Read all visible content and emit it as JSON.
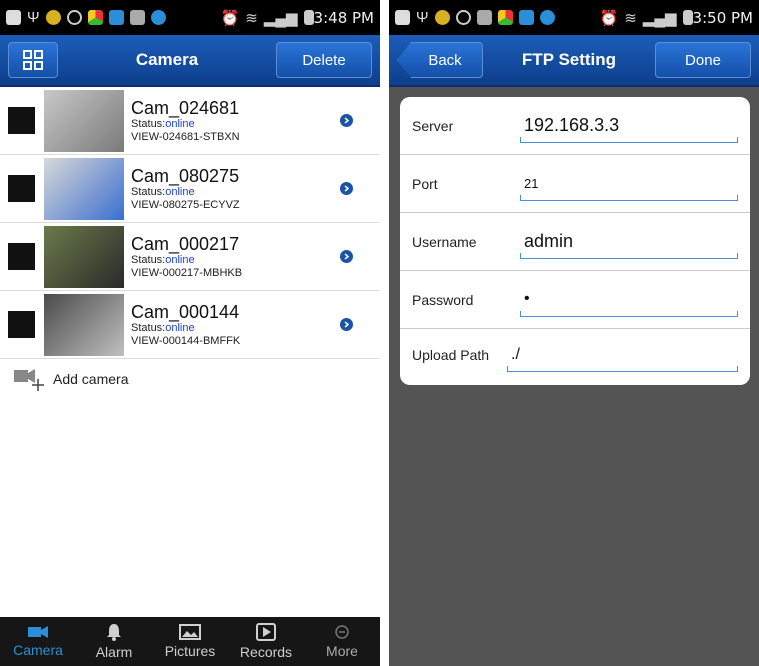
{
  "left": {
    "status_bar": {
      "time": "3:48 PM"
    },
    "header": {
      "title": "Camera",
      "delete_label": "Delete"
    },
    "cameras": [
      {
        "name": "Cam_024681",
        "status_label": "Status:",
        "status_value": "online",
        "uid": "VIEW-024681-STBXN",
        "thumb_colors": [
          "#c8c8c8",
          "#7a7a7a"
        ]
      },
      {
        "name": "Cam_080275",
        "status_label": "Status:",
        "status_value": "online",
        "uid": "VIEW-080275-ECYVZ",
        "thumb_colors": [
          "#d8d8d8",
          "#3a6fd0"
        ]
      },
      {
        "name": "Cam_000217",
        "status_label": "Status:",
        "status_value": "online",
        "uid": "VIEW-000217-MBHKB",
        "thumb_colors": [
          "#6a7a4a",
          "#2a2a2a"
        ]
      },
      {
        "name": "Cam_000144",
        "status_label": "Status:",
        "status_value": "online",
        "uid": "VIEW-000144-BMFFK",
        "thumb_colors": [
          "#4a4a4a",
          "#c0c0c0"
        ]
      }
    ],
    "add_camera_label": "Add camera",
    "tabs": [
      {
        "label": "Camera",
        "icon": "camera-icon",
        "active": true
      },
      {
        "label": "Alarm",
        "icon": "bell-icon",
        "active": false
      },
      {
        "label": "Pictures",
        "icon": "picture-icon",
        "active": false
      },
      {
        "label": "Records",
        "icon": "play-icon",
        "active": false
      },
      {
        "label": "More",
        "icon": "more-icon",
        "active": false
      }
    ]
  },
  "right": {
    "status_bar": {
      "time": "3:50 PM"
    },
    "header": {
      "back_label": "Back",
      "title": "FTP Setting",
      "done_label": "Done"
    },
    "fields": {
      "server": {
        "label": "Server",
        "value": "192.168.3.3"
      },
      "port": {
        "label": "Port",
        "value": "21"
      },
      "username": {
        "label": "Username",
        "value": "admin"
      },
      "password": {
        "label": "Password",
        "value": "•"
      },
      "upload_path": {
        "label": "Upload Path",
        "value": "./"
      }
    }
  },
  "colors": {
    "nav_blue": "#1450a8",
    "accent": "#2a8fd8",
    "online": "#1a3fd8"
  }
}
